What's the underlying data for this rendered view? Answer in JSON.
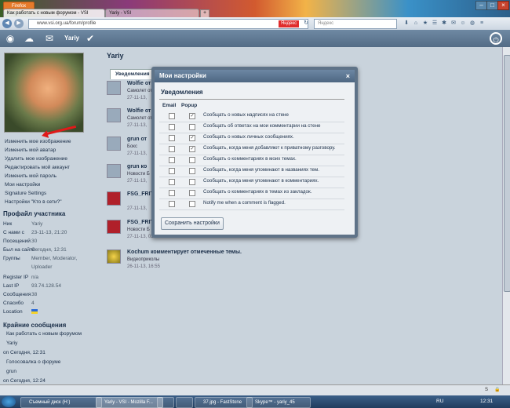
{
  "browser": {
    "app_button": "Firefox",
    "tabs": [
      {
        "label": "Как работать с новым форумом - VSI"
      },
      {
        "label": "Yariy - VSI"
      }
    ],
    "url": "www.vsi.org.ua/forum/profile",
    "search_engine_tag": "Яндекс",
    "search_placeholder": "Яндекс"
  },
  "site": {
    "username": "Yariy"
  },
  "left_menu": [
    "Изменить мое изображение",
    "Изменить мой аватар",
    "Удалить мое изображение",
    "Редактировать мой аккаунт",
    "Изменить мой пароль",
    "Мои настройки",
    "Signature Settings",
    "Настройки \"Кто в сети?\""
  ],
  "profile": {
    "title": "Профайл участника",
    "rows": [
      {
        "label": "Ник",
        "value": "Yariy"
      },
      {
        "label": "С нами с",
        "value": "23-11-13, 21:20"
      },
      {
        "label": "Посещений",
        "value": "30"
      },
      {
        "label": "Был на сайте",
        "value": "Сегодня, 12:31"
      },
      {
        "label": "Группы",
        "value": "Member, Moderator,"
      },
      {
        "label": "",
        "value": "Uploader"
      },
      {
        "label": "Register IP",
        "value": "n/a"
      },
      {
        "label": "Last IP",
        "value": "93.74.128.54"
      },
      {
        "label": "Сообщения",
        "value": "38"
      },
      {
        "label": "Спасибо",
        "value": "4"
      },
      {
        "label": "Location",
        "value": ""
      }
    ]
  },
  "recent": {
    "title": "Крайние сообщения",
    "items": [
      "Как работать с новым форумом",
      "Yariy",
      "on Сегодня, 12:31",
      "Голосовалка о форуме",
      "grun",
      "on Сегодня, 12:24"
    ]
  },
  "main": {
    "username": "Yariy",
    "tab": "Уведомления",
    "feed": [
      {
        "name": "Wolfie от",
        "sub": "Самолет от",
        "time": "27-11-13,"
      },
      {
        "name": "Wolfie от",
        "sub": "Самолет от",
        "time": "27-11-13,"
      },
      {
        "name": "grun от",
        "sub": "Бокс",
        "time": "27-11-13,"
      },
      {
        "name": "grun кo",
        "sub": "Новости Б",
        "time": "27-11-13,"
      },
      {
        "name": "FSG_FRIT",
        "sub": "",
        "time": "27-11-13,"
      },
      {
        "name": "FSG_FRIT",
        "sub": "Новости Б",
        "time": "27-11-13, 03:32"
      },
      {
        "name": "Kochum комментирует отмеченные темы.",
        "sub": "Видеоприколы",
        "time": "26-11-13, 16:55"
      }
    ]
  },
  "modal": {
    "title": "Мои настройки",
    "close": "×",
    "subtitle": "Уведомления",
    "col_email": "Email",
    "col_popup": "Popup",
    "options": [
      {
        "label": "Сообщать о новых надписях на стене",
        "email": false,
        "popup": true
      },
      {
        "label": "Сообщать об ответах на мои комментарии на стене",
        "email": false,
        "popup": false
      },
      {
        "label": "Сообщать о новых личных сообщениях.",
        "email": false,
        "popup": true
      },
      {
        "label": "Сообщать, когда меня добавляют к приватному разговору.",
        "email": false,
        "popup": true
      },
      {
        "label": "Сообщать о комментариях в моих темах.",
        "email": false,
        "popup": false
      },
      {
        "label": "Сообщать, когда меня упоминают в названиях тем.",
        "email": false,
        "popup": false
      },
      {
        "label": "Сообщать, когда меня упоминают в комментариях.",
        "email": false,
        "popup": false
      },
      {
        "label": "Сообщать о комментариях в темах из закладок.",
        "email": false,
        "popup": false
      },
      {
        "label": "Notify me when a comment is flagged.",
        "email": false,
        "popup": false
      }
    ],
    "save_label": "Сохранить настройки"
  },
  "taskbar": {
    "items": [
      "Съемный диск (H:)",
      "Yariy - VSI - Mozilla F...",
      "",
      "",
      "37.jpg - FastStone",
      "Skype™ - yariy_45"
    ],
    "lang": "RU",
    "clock": "12:31"
  }
}
